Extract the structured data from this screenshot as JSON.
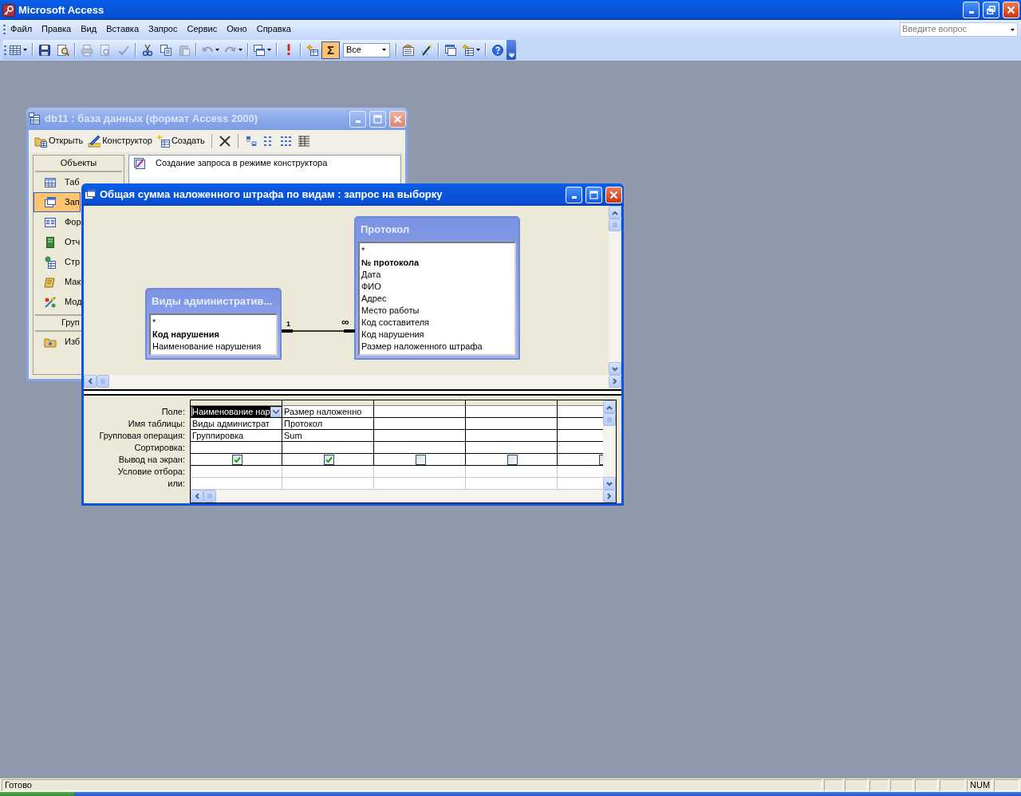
{
  "app": {
    "title": "Microsoft Access",
    "menu": [
      "Файл",
      "Правка",
      "Вид",
      "Вставка",
      "Запрос",
      "Сервис",
      "Окно",
      "Справка"
    ],
    "help_field": {
      "placeholder": "Введите вопрос"
    },
    "toolbar": [
      {
        "kind": "button",
        "dropdown": true,
        "disabled": false
      },
      {
        "kind": "separator"
      },
      {
        "kind": "button",
        "disabled": false
      },
      {
        "kind": "button",
        "disabled": false
      },
      {
        "kind": "separator"
      },
      {
        "kind": "button",
        "disabled": true
      },
      {
        "kind": "button",
        "disabled": true
      },
      {
        "kind": "button",
        "disabled": true
      },
      {
        "kind": "separator"
      },
      {
        "kind": "button",
        "disabled": false
      },
      {
        "kind": "button",
        "disabled": false
      },
      {
        "kind": "button",
        "disabled": true
      },
      {
        "kind": "separator"
      },
      {
        "kind": "button",
        "dropdown": true,
        "disabled": true
      },
      {
        "kind": "button",
        "dropdown": true,
        "disabled": true
      },
      {
        "kind": "separator"
      },
      {
        "kind": "button",
        "dropdown": true,
        "disabled": false
      },
      {
        "kind": "separator"
      },
      {
        "kind": "button",
        "disabled": false
      },
      {
        "kind": "separator"
      },
      {
        "kind": "button",
        "disabled": false
      },
      {
        "kind": "toggle",
        "text": "Σ",
        "selected": true
      },
      {
        "kind": "combo",
        "value": "Все"
      },
      {
        "kind": "separator"
      },
      {
        "kind": "button",
        "disabled": false
      },
      {
        "kind": "button",
        "disabled": false
      },
      {
        "kind": "separator"
      },
      {
        "kind": "button",
        "disabled": false
      },
      {
        "kind": "button",
        "dropdown": true,
        "disabled": false
      },
      {
        "kind": "separator"
      },
      {
        "kind": "button",
        "disabled": false
      }
    ]
  },
  "db_window": {
    "title": "db11 : база данных (формат Access 2000)",
    "active": false,
    "toolbar": [
      {
        "kind": "button",
        "label": "Открыть"
      },
      {
        "kind": "button",
        "label": "Конструктор"
      },
      {
        "kind": "button",
        "label": "Создать"
      },
      {
        "kind": "separator"
      },
      {
        "kind": "icon"
      },
      {
        "kind": "separator"
      },
      {
        "kind": "icon"
      },
      {
        "kind": "icon"
      },
      {
        "kind": "icon"
      },
      {
        "kind": "icon"
      }
    ],
    "objects_header": "Объекты",
    "objects": [
      {
        "label": "Таб",
        "selected": false
      },
      {
        "label": "Зап",
        "selected": true
      },
      {
        "label": "Фор",
        "selected": false
      },
      {
        "label": "Отч",
        "selected": false
      },
      {
        "label": "Стр",
        "selected": false
      },
      {
        "label": "Мак",
        "selected": false
      },
      {
        "label": "Мод",
        "selected": false
      }
    ],
    "groups_header": "Груп",
    "groups": [
      {
        "label": "Изб",
        "selected": false
      }
    ],
    "list": [
      "Создание запроса в режиме конструктора"
    ]
  },
  "query_window": {
    "title": "Общая сумма наложенного штрафа по видам : запрос на выборку",
    "active": true,
    "tables": [
      {
        "title": "Виды административ...",
        "fields": [
          {
            "name": "*",
            "key": false
          },
          {
            "name": "Код нарушения",
            "key": true
          },
          {
            "name": "Наименование нарушения",
            "key": false
          }
        ]
      },
      {
        "title": "Протокол",
        "fields": [
          {
            "name": "*",
            "key": false
          },
          {
            "name": "№ протокола",
            "key": true
          },
          {
            "name": "Дата",
            "key": false
          },
          {
            "name": "ФИО",
            "key": false
          },
          {
            "name": "Адрес",
            "key": false
          },
          {
            "name": "Место работы",
            "key": false
          },
          {
            "name": "Код составителя",
            "key": false
          },
          {
            "name": "Код нарушения",
            "key": false
          },
          {
            "name": "Размер наложенного штрафа",
            "key": false
          }
        ]
      }
    ],
    "relation": {
      "from_label": "1",
      "to_label": "∞"
    },
    "grid_rows": [
      "Поле:",
      "Имя таблицы:",
      "Групповая операция:",
      "Сортировка:",
      "Вывод на экран:",
      "Условие отбора:",
      "или:"
    ],
    "grid_columns": [
      {
        "field": "Наименование нар",
        "table": "Виды администрат",
        "total": "Группировка",
        "show": true,
        "selected": true
      },
      {
        "field": "Размер наложенно",
        "table": "Протокол",
        "total": "Sum",
        "show": true,
        "selected": false
      },
      {
        "show": false,
        "selected": false
      },
      {
        "show": false,
        "selected": false
      },
      {
        "show": false,
        "selected": false
      }
    ]
  },
  "status_bar": {
    "message": "Готово",
    "indicator": "NUM"
  }
}
